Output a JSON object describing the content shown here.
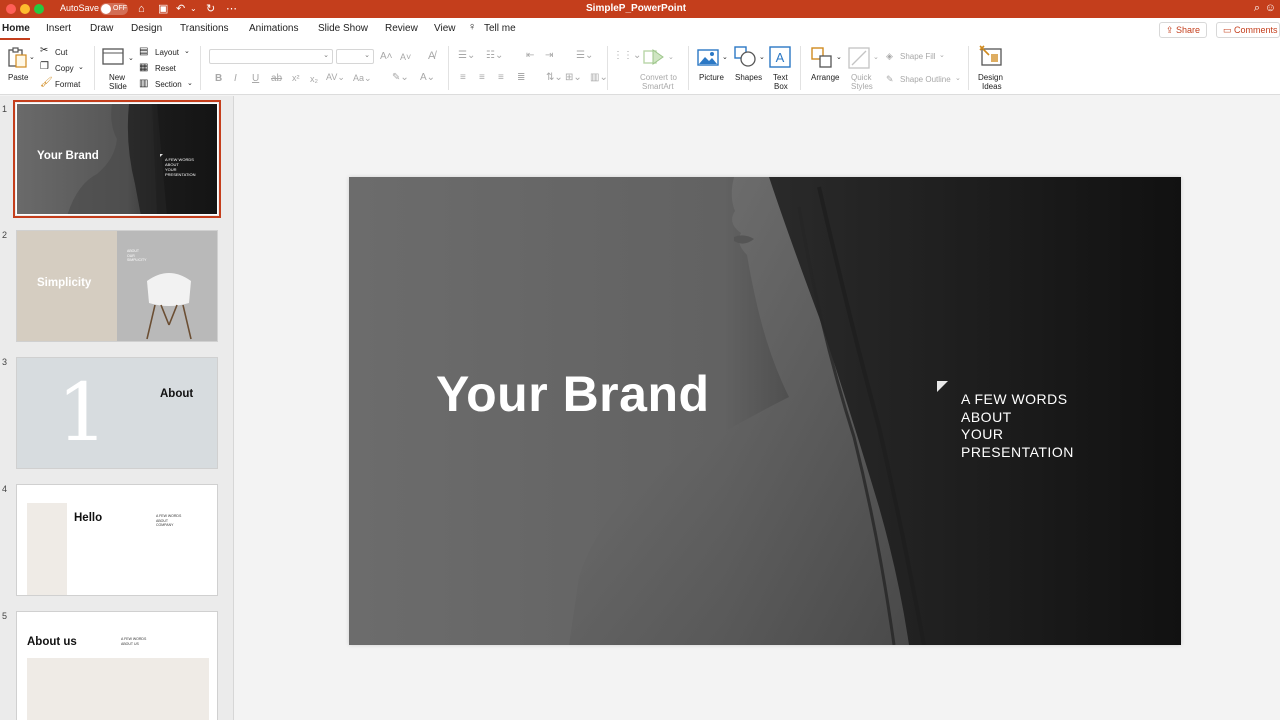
{
  "titlebar": {
    "autosave_label": "AutoSave",
    "autosave_state": "OFF",
    "document_title": "SimpleP_PowerPoint"
  },
  "tabs": [
    "Home",
    "Insert",
    "Draw",
    "Design",
    "Transitions",
    "Animations",
    "Slide Show",
    "Review",
    "View"
  ],
  "tell_me": "Tell me",
  "share_label": "Share",
  "comments_label": "Comments",
  "ribbon": {
    "paste": "Paste",
    "cut": "Cut",
    "copy": "Copy",
    "format": "Format",
    "new_slide_1": "New",
    "new_slide_2": "Slide",
    "layout": "Layout",
    "reset": "Reset",
    "section": "Section",
    "convert_1": "Convert to",
    "convert_2": "SmartArt",
    "picture": "Picture",
    "shapes": "Shapes",
    "textbox_1": "Text",
    "textbox_2": "Box",
    "arrange": "Arrange",
    "quick_styles_1": "Quick",
    "quick_styles_2": "Styles",
    "shape_fill": "Shape Fill",
    "shape_outline": "Shape Outline",
    "design_ideas_1": "Design",
    "design_ideas_2": "Ideas"
  },
  "slides": [
    {
      "number": "1",
      "title": "Your Brand",
      "sub": [
        "A FEW WORDS",
        "ABOUT",
        "YOUR",
        "PRESENTATION"
      ]
    },
    {
      "number": "2",
      "title": "Simplicity",
      "sub": [
        "ABOUT",
        "OUR",
        "SIMPLICITY"
      ]
    },
    {
      "number": "3",
      "title": "About",
      "big_number": "1"
    },
    {
      "number": "4",
      "title": "Hello",
      "sub": [
        "A FEW WORDS",
        "ABOUT",
        "COMPANY"
      ]
    },
    {
      "number": "5",
      "title": "About us",
      "sub": [
        "A FEW WORDS",
        "ABOUT US"
      ]
    }
  ],
  "main_slide": {
    "title": "Your Brand",
    "sub": [
      "A FEW WORDS",
      "ABOUT",
      "YOUR",
      "PRESENTATION"
    ]
  },
  "colors": {
    "accent": "#c43e1c",
    "slide_dark": "#141414",
    "slide_grey": "#6a6a6a"
  }
}
